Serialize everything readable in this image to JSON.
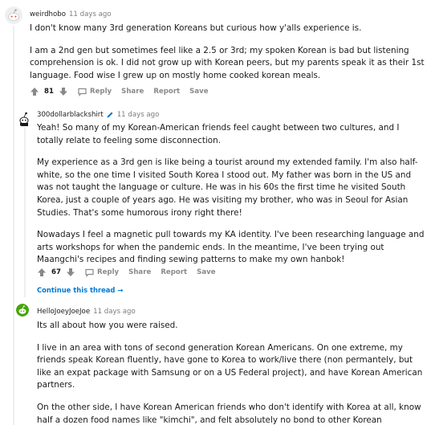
{
  "comments": [
    {
      "username": "weirdhobo",
      "timestamp": "11 days ago",
      "paragraphs": [
        "I don't know many 3rd generation Koreans but curious how y'alls experience is.",
        "I am a 2nd gen but sometimes feel like a 2.5 or 3rd; my spoken Korean is bad but listening comprehension is ok. I did not grow up with Korean peers, but my parents speak it as their 1st language. Food wise I grew up on mostly home cooked korean meals."
      ],
      "score": "81",
      "reply_label": "Reply",
      "share_label": "Share",
      "report_label": "Report",
      "save_label": "Save"
    },
    {
      "username": "300dollarblackshirt",
      "timestamp": "11 days ago",
      "paragraphs": [
        "Yeah! So many of my Korean-American friends feel caught between two cultures, and I totally relate to feeling some disconnection.",
        "My experience as a 3rd gen is like being a tourist around my extended family. I'm also half-white, so the one time I visited South Korea I stood out. My father was born in the US and was not taught the language or culture. He was in his 60s the first time he visited South Korea, just a couple of years ago. He was visiting my brother, who was in Seoul for Asian Studies. That's some humorous irony right there!",
        "Nowadays I feel a magnetic pull towards my KA identity. I've been researching language and arts workshops for when the pandemic ends. In the meantime, I've been trying out Maangchi's recipes and finding sewing patterns to make my own hanbok!"
      ],
      "score": "67",
      "reply_label": "Reply",
      "share_label": "Share",
      "report_label": "Report",
      "save_label": "Save",
      "continue_label": "Continue this thread →"
    },
    {
      "username": "HelloJoeyJoeJoe",
      "timestamp": "11 days ago",
      "paragraphs": [
        "Its all about how you were raised.",
        "I live in an area with tons of second generation Korean Americans. On one extreme, my friends speak Korean fluently, have gone to Korea to work/live there (non permantely, but like an expat package with Samsung or on a US Federal project), and have Korean American partners.",
        "On the other side, I have Korean American friends who don't identify with Korea at all, know half a dozen food names like \"kimchi\", and felt absolutely no bond to other Korean Americans. Like we are friends with no influence from social/cultural connections."
      ]
    }
  ],
  "colors": {
    "link": "#0079d3",
    "meta": "#7c7c7c",
    "action": "#878a8c",
    "thread_line": "#edeff1"
  }
}
